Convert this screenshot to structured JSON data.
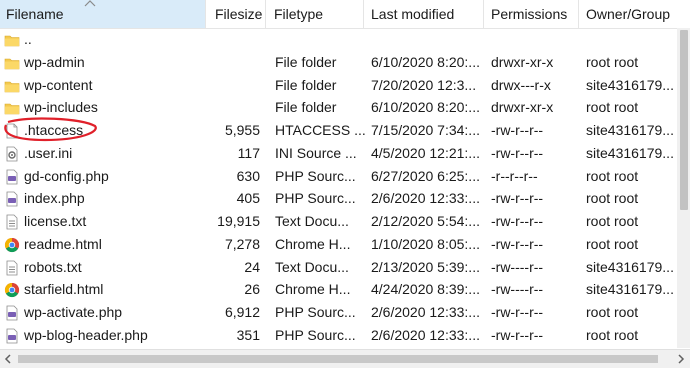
{
  "columns": {
    "filename": "Filename",
    "filesize": "Filesize",
    "filetype": "Filetype",
    "last_modified": "Last modified",
    "permissions": "Permissions",
    "owner_group": "Owner/Group"
  },
  "files": [
    {
      "name": "..",
      "size": "",
      "type": "",
      "modified": "",
      "perms": "",
      "owner": "",
      "icon": "folder-icon"
    },
    {
      "name": "wp-admin",
      "size": "",
      "type": "File folder",
      "modified": "6/10/2020 8:20:...",
      "perms": "drwxr-xr-x",
      "owner": "root root",
      "icon": "folder-icon"
    },
    {
      "name": "wp-content",
      "size": "",
      "type": "File folder",
      "modified": "7/20/2020 12:3...",
      "perms": "drwx---r-x",
      "owner": "site4316179...",
      "icon": "folder-icon"
    },
    {
      "name": "wp-includes",
      "size": "",
      "type": "File folder",
      "modified": "6/10/2020 8:20:...",
      "perms": "drwxr-xr-x",
      "owner": "root root",
      "icon": "folder-icon"
    },
    {
      "name": ".htaccess",
      "size": "5,955",
      "type": "HTACCESS ...",
      "modified": "7/15/2020 7:34:...",
      "perms": "-rw-r--r--",
      "owner": "site4316179...",
      "icon": "file-icon"
    },
    {
      "name": ".user.ini",
      "size": "117",
      "type": "INI Source ...",
      "modified": "4/5/2020 12:21:...",
      "perms": "-rw-r--r--",
      "owner": "site4316179...",
      "icon": "settings-file-icon"
    },
    {
      "name": "gd-config.php",
      "size": "630",
      "type": "PHP Sourc...",
      "modified": "6/27/2020 6:25:...",
      "perms": "-r--r--r--",
      "owner": "root root",
      "icon": "php-file-icon"
    },
    {
      "name": "index.php",
      "size": "405",
      "type": "PHP Sourc...",
      "modified": "2/6/2020 12:33:...",
      "perms": "-rw-r--r--",
      "owner": "root root",
      "icon": "php-file-icon"
    },
    {
      "name": "license.txt",
      "size": "19,915",
      "type": "Text Docu...",
      "modified": "2/12/2020 5:54:...",
      "perms": "-rw-r--r--",
      "owner": "root root",
      "icon": "text-file-icon"
    },
    {
      "name": "readme.html",
      "size": "7,278",
      "type": "Chrome H...",
      "modified": "1/10/2020 8:05:...",
      "perms": "-rw-r--r--",
      "owner": "root root",
      "icon": "chrome-icon"
    },
    {
      "name": "robots.txt",
      "size": "24",
      "type": "Text Docu...",
      "modified": "2/13/2020 5:39:...",
      "perms": "-rw----r--",
      "owner": "site4316179...",
      "icon": "text-file-icon"
    },
    {
      "name": "starfield.html",
      "size": "26",
      "type": "Chrome H...",
      "modified": "4/24/2020 8:39:...",
      "perms": "-rw----r--",
      "owner": "site4316179...",
      "icon": "chrome-icon"
    },
    {
      "name": "wp-activate.php",
      "size": "6,912",
      "type": "PHP Sourc...",
      "modified": "2/6/2020 12:33:...",
      "perms": "-rw-r--r--",
      "owner": "root root",
      "icon": "php-file-icon"
    },
    {
      "name": "wp-blog-header.php",
      "size": "351",
      "type": "PHP Sourc...",
      "modified": "2/6/2020 12:33:...",
      "perms": "-rw-r--r--",
      "owner": "root root",
      "icon": "php-file-icon"
    }
  ],
  "highlight_color": "#e0202a",
  "header_active_color": "#d9ebf9"
}
